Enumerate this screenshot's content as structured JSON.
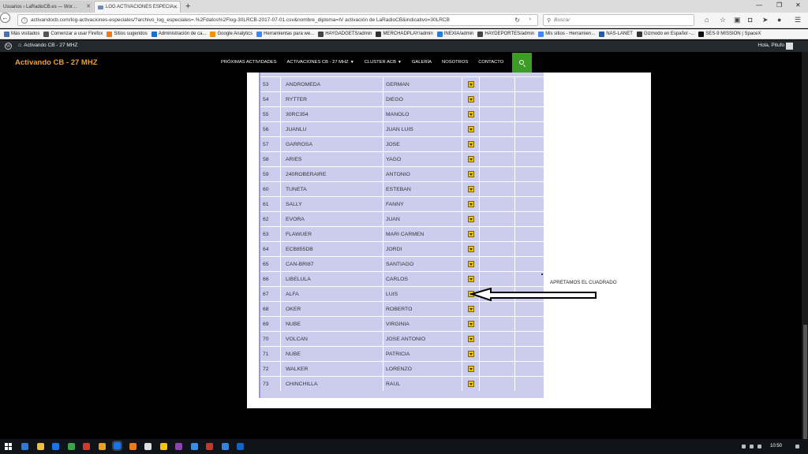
{
  "browser": {
    "tabs": [
      {
        "label": "Usuarios ‹ LaRadioCB.es — Wor…",
        "active": false
      },
      {
        "label": "LOG ACTIVACIONES ESPECIA…",
        "active": true
      }
    ],
    "new_tab_label": "+",
    "url": "activandocb.com/log-activaciones-especiales/?archivo_log_especiales=.%2Fdatos%2Flog-30LRCB-2017-07-01.csv&nombre_diploma=IV activación de LaRadioCB&indicativo=30LRCB",
    "search_placeholder": "Buscar",
    "bookmarks": [
      {
        "label": "Más visitados",
        "color": "#4a6fb5"
      },
      {
        "label": "Comenzar a usar Firefox",
        "color": "#555555"
      },
      {
        "label": "Sitios sugeridos",
        "color": "#e87b1c"
      },
      {
        "label": "Administración de ca...",
        "color": "#1a73c8"
      },
      {
        "label": "Google Analytics",
        "color": "#f09300"
      },
      {
        "label": "Herramientas para we...",
        "color": "#4285f4"
      },
      {
        "label": "HAYGADGETS/admin",
        "color": "#444444"
      },
      {
        "label": "MERCHADPLAY/admin",
        "color": "#333333"
      },
      {
        "label": "INEXIA/admin",
        "color": "#2a7bd0"
      },
      {
        "label": "HAYDEPORTES/admin",
        "color": "#444444"
      },
      {
        "label": "Mis sitios - Herramien...",
        "color": "#4285f4"
      },
      {
        "label": "NAS-LANET",
        "color": "#1f5fa8"
      },
      {
        "label": "Gizmodo en Español -...",
        "color": "#333333"
      },
      {
        "label": "SES-9 MISSION | SpaceX",
        "color": "#111111"
      }
    ]
  },
  "wp_admin": {
    "site_name": "Activando CB - 27 MHZ",
    "howdy": "Hola, Pitufo"
  },
  "site": {
    "title": "Activando CB - 27 MHZ",
    "nav": [
      {
        "label": "PRÓXIMAS ACTIVIDADES",
        "has_caret": false
      },
      {
        "label": "ACTIVACIONES CB - 27 MHZ",
        "has_caret": true
      },
      {
        "label": "CLUSTER ACB",
        "has_caret": true
      },
      {
        "label": "GALERÍA",
        "has_caret": false
      },
      {
        "label": "NOSOTROS",
        "has_caret": false
      },
      {
        "label": "CONTACTO",
        "has_caret": false
      }
    ]
  },
  "log_table": {
    "rows": [
      {
        "num": "53",
        "indicativo": "ANDROMEDA",
        "nombre": "GERMAN"
      },
      {
        "num": "54",
        "indicativo": "RYTTER",
        "nombre": "DIEGO"
      },
      {
        "num": "55",
        "indicativo": "30RC354",
        "nombre": "MANOLO"
      },
      {
        "num": "56",
        "indicativo": "JUANLU",
        "nombre": "JUAN LUIS"
      },
      {
        "num": "57",
        "indicativo": "GARROSA",
        "nombre": "JOSE"
      },
      {
        "num": "58",
        "indicativo": "ARIES",
        "nombre": "YAGO"
      },
      {
        "num": "59",
        "indicativo": "240ROBERAIRE",
        "nombre": "ANTONIO"
      },
      {
        "num": "60",
        "indicativo": "TUNETA",
        "nombre": "ESTEBAN"
      },
      {
        "num": "61",
        "indicativo": "SALLY",
        "nombre": "FANNY"
      },
      {
        "num": "62",
        "indicativo": "EVORA",
        "nombre": "JUAN"
      },
      {
        "num": "63",
        "indicativo": "FLAWUER",
        "nombre": "MARI CARMEN"
      },
      {
        "num": "64",
        "indicativo": "ECB855DB",
        "nombre": "JORDI"
      },
      {
        "num": "65",
        "indicativo": "CAN-BRI87",
        "nombre": "SANTIAGO"
      },
      {
        "num": "66",
        "indicativo": "LIBELULA",
        "nombre": "CARLOS"
      },
      {
        "num": "67",
        "indicativo": "ALFA",
        "nombre": "LUIS"
      },
      {
        "num": "68",
        "indicativo": "OKER",
        "nombre": "ROBERTO"
      },
      {
        "num": "69",
        "indicativo": "NUBE",
        "nombre": "VIRGINIA"
      },
      {
        "num": "70",
        "indicativo": "VOLCAN",
        "nombre": "JOSE ANTONIO"
      },
      {
        "num": "71",
        "indicativo": "NUBE",
        "nombre": "PATRICIA"
      },
      {
        "num": "72",
        "indicativo": "WALKER",
        "nombre": "LORENZO"
      },
      {
        "num": "73",
        "indicativo": "CHINCHILLA",
        "nombre": "RAUL"
      }
    ]
  },
  "annotation": {
    "text": "APRETAMOS EL CUADRADO"
  },
  "taskbar": {
    "clock": "10:50",
    "apps": [
      "#2b7bd6",
      "#f0c040",
      "#1a73e8",
      "#3da34a",
      "#d03a2a",
      "#e8a020",
      "#1a73e8",
      "#e87b1c",
      "#e0e0e0",
      "#f7c600",
      "#8e44ad",
      "#3a8ee0",
      "#c0392b",
      "#2e86de",
      "#1565c0"
    ]
  },
  "colors": {
    "accent_green": "#3d9c24",
    "site_title_orange": "#f0a030",
    "table_bg": "#ccccee"
  }
}
